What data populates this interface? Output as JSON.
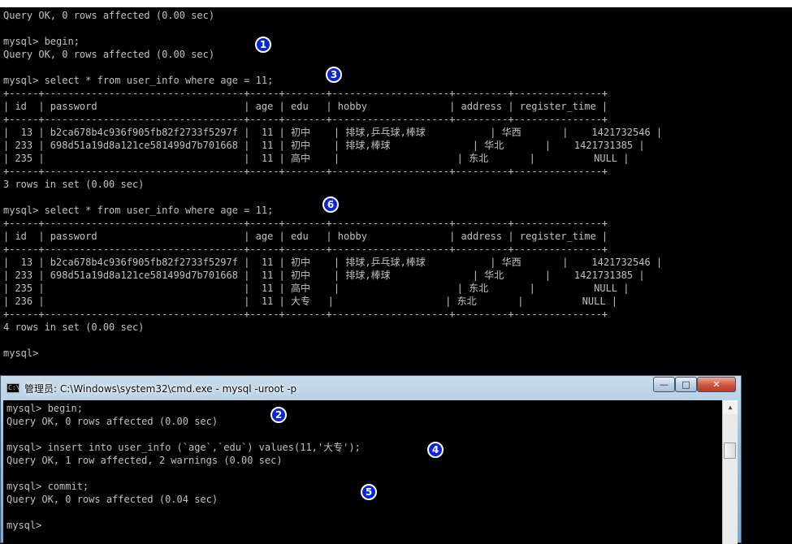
{
  "main_terminal": {
    "lines": [
      "Query OK, 0 rows affected (0.00 sec)",
      "",
      "mysql> begin;",
      "Query OK, 0 rows affected (0.00 sec)",
      "",
      "mysql> select * from user_info where age = 11;",
      "+-----+----------------------------------+-----+-------+--------------------+---------+---------------+",
      "| id  | password                         | age | edu   | hobby              | address | register_time |",
      "+-----+----------------------------------+-----+-------+--------------------+---------+---------------+",
      "|  13 | b2ca678b4c936f905fb82f2733f5297f |  11 | 初中    | 排球,乒乓球,棒球           | 华西       |    1421732546 |",
      "| 233 | 698d51a19d8a121ce581499d7b701668 |  11 | 初中    | 排球,棒球              | 华北       |    1421731385 |",
      "| 235 |                                  |  11 | 高中    |                    | 东北       |          NULL |",
      "+-----+----------------------------------+-----+-------+--------------------+---------+---------------+",
      "3 rows in set (0.00 sec)",
      "",
      "mysql> select * from user_info where age = 11;",
      "+-----+----------------------------------+-----+-------+--------------------+---------+---------------+",
      "| id  | password                         | age | edu   | hobby              | address | register_time |",
      "+-----+----------------------------------+-----+-------+--------------------+---------+---------------+",
      "|  13 | b2ca678b4c936f905fb82f2733f5297f |  11 | 初中    | 排球,乒乓球,棒球           | 华西       |    1421732546 |",
      "| 233 | 698d51a19d8a121ce581499d7b701668 |  11 | 初中    | 排球,棒球              | 华北       |    1421731385 |",
      "| 235 |                                  |  11 | 高中    |                    | 东北       |          NULL |",
      "| 236 |                                  |  11 | 大专   |                   | 东北       |          NULL |",
      "+-----+----------------------------------+-----+-------+--------------------+---------+---------------+",
      "4 rows in set (0.00 sec)",
      "",
      "mysql>"
    ]
  },
  "second_window": {
    "title": "管理员: C:\\Windows\\system32\\cmd.exe - mysql  -uroot -p",
    "buttons": {
      "minimize": "—",
      "maximize": "□",
      "close": "✕"
    },
    "lines": [
      "mysql> begin;",
      "Query OK, 0 rows affected (0.00 sec)",
      "",
      "mysql> insert into user_info (`age`,`edu`) values(11,'大专');",
      "Query OK, 1 row affected, 2 warnings (0.00 sec)",
      "",
      "mysql> commit;",
      "Query OK, 0 rows affected (0.04 sec)",
      "",
      "mysql>"
    ],
    "scrollbar": {
      "up_icon": "up-arrow-icon",
      "down_icon": "down-arrow-icon"
    }
  },
  "step_badges": {
    "b1": "1",
    "b2": "2",
    "b3": "3",
    "b4": "4",
    "b5": "5",
    "b6": "6"
  },
  "colors": {
    "terminal_bg": "#000000",
    "terminal_fg": "#c0c0c0",
    "badge_fill": "#0a24d8",
    "titlebar": "#9dc0dc"
  }
}
